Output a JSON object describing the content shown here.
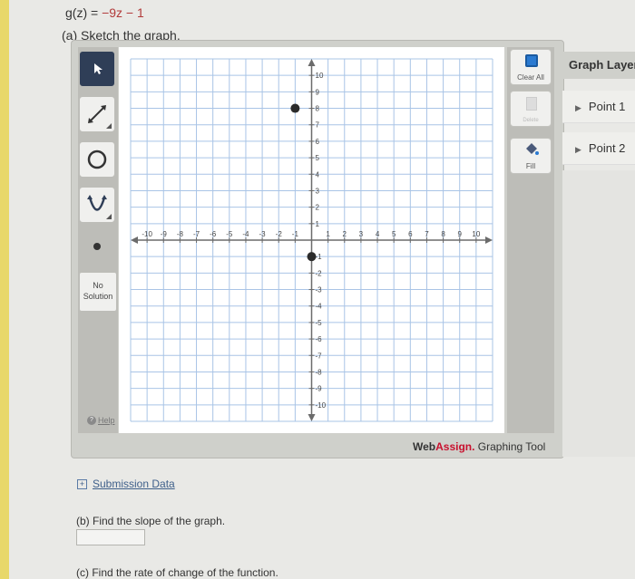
{
  "question": {
    "function_label": "g(z) = ",
    "function_expr": "−9z − 1",
    "part_a": "(a) Sketch the graph.",
    "part_b": "(b) Find the slope of the graph.",
    "part_c": "(c) Find the rate of change of the function.",
    "slope_answer": ""
  },
  "tools": {
    "no_solution": "No Solution",
    "help": "Help",
    "clear_all": "Clear All",
    "delete": "Delete",
    "fill": "Fill"
  },
  "layers": {
    "header": "Graph Layers",
    "items": [
      "Point 1",
      "Point 2"
    ]
  },
  "branding": {
    "web": "Web",
    "assign": "Assign.",
    "rest": " Graphing Tool"
  },
  "submission": {
    "label": "Submission Data"
  },
  "graph": {
    "x_range": [
      -10,
      10
    ],
    "y_range": [
      -10,
      10
    ],
    "x_tick_labels": [
      "-10",
      "-9",
      "-8",
      "-7",
      "-6",
      "-5",
      "-4",
      "-3",
      "-2",
      "-1",
      "1",
      "2",
      "3",
      "4",
      "5",
      "6",
      "7",
      "8",
      "9",
      "10"
    ],
    "y_tick_labels": [
      "10",
      "9",
      "8",
      "7",
      "6",
      "5",
      "4",
      "3",
      "2",
      "1",
      "-1",
      "-2",
      "-3",
      "-4",
      "-5",
      "-6",
      "-7",
      "-8",
      "-9",
      "-10"
    ],
    "points": [
      {
        "name": "Point 1",
        "x": -1,
        "y": 8
      },
      {
        "name": "Point 2",
        "x": 0,
        "y": -1
      }
    ],
    "colors": {
      "grid": "#a9c4e6",
      "axis": "#6b6b6b",
      "point": "#2b2b2b"
    }
  }
}
